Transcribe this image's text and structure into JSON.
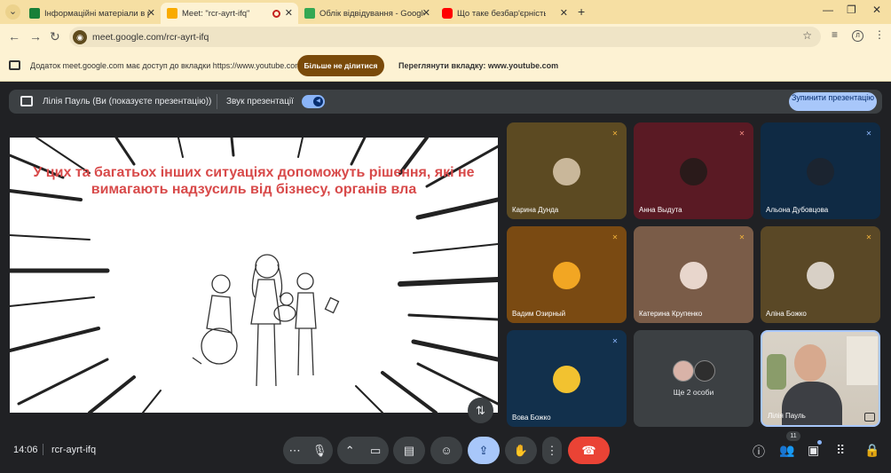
{
  "browser": {
    "tabs": [
      {
        "title": "Інформаційні матеріали в рам",
        "favicon_color": "#188038",
        "favicon": "classroom-icon"
      },
      {
        "title": "Meet: \"rcr-ayrt-ifq\"",
        "favicon_color": "#f9ab00",
        "favicon": "meet-icon"
      },
      {
        "title": "Облік відвідування - Google Т",
        "favicon_color": "#34a853",
        "favicon": "sheets-icon"
      },
      {
        "title": "Що таке безбар'єрність і ч",
        "favicon_color": "#ff0000",
        "favicon": "youtube-icon"
      }
    ],
    "url": "meet.google.com/rcr-ayrt-ifq",
    "profile_initial": "Л"
  },
  "infobar": {
    "message": "Додаток meet.google.com має доступ до вкладки https://www.youtube.com",
    "stop_sharing_label": "Більше не ділитися",
    "view_tab_label": "Переглянути вкладку: www.youtube.com"
  },
  "presenting": {
    "presenter_text": "Лілія Пауль (Ви (показуєте презентацію))",
    "sound_label": "Звук презентації",
    "sound_on": true,
    "stop_button": "Зупинити презентацію"
  },
  "slide": {
    "text": "У цих та багатьох інших ситуаціях допоможуть рішення, які не вимагають надзусиль від бізнесу, органів вла"
  },
  "participants": [
    {
      "name": "Карина Дунда",
      "muted": true,
      "bg": "#5c4a22",
      "avatar_color": "#c9b79a"
    },
    {
      "name": "Анна Выдута",
      "muted": true,
      "bg": "#5a1a24",
      "avatar_color": "#2a1a1a"
    },
    {
      "name": "Альона Дубовцова",
      "muted": true,
      "bg": "#0f2a44",
      "avatar_color": "#1b2430"
    },
    {
      "name": "Вадим Озирный",
      "muted": true,
      "bg": "#7a4a12",
      "avatar_color": "#f2a623"
    },
    {
      "name": "Катерина Крупенко",
      "muted": true,
      "bg": "#7a5c48",
      "avatar_color": "#e8d6cc"
    },
    {
      "name": "Аліна Божко",
      "muted": true,
      "bg": "#5a4826",
      "avatar_color": "#d8d0c6"
    },
    {
      "name": "Вова Божко",
      "muted": true,
      "bg": "#12304c",
      "avatar_color": "#f2c230"
    }
  ],
  "more_participants": {
    "label": "Ще 2 особи"
  },
  "self_view": {
    "name": "Лілія Пауль"
  },
  "footer": {
    "time": "14:06",
    "meeting_code": "rcr-ayrt-ifq",
    "people_count": "11"
  }
}
